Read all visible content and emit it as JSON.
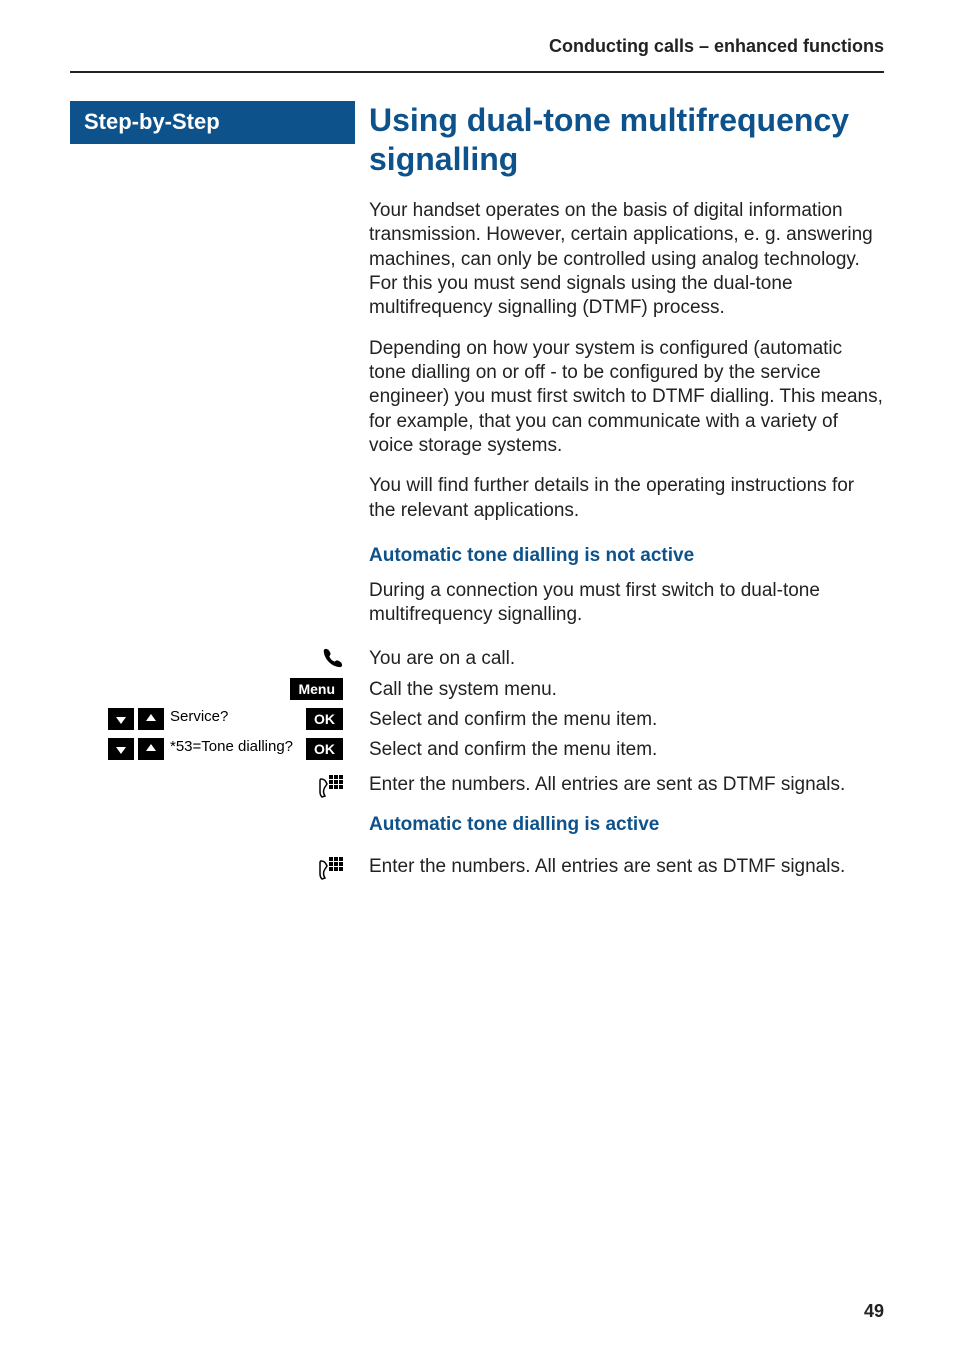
{
  "header": {
    "running_title": "Conducting calls – enhanced functions"
  },
  "sidebar": {
    "title": "Step-by-Step"
  },
  "main": {
    "title": "Using dual-tone multifrequency signalling",
    "paragraphs": [
      "Your handset operates on the basis of digital information transmission. However, certain applications, e. g. answering machines, can only be controlled using analog technology. For this you must send signals using the dual-tone multifrequency signalling (DTMF) process.",
      "Depending on how your system is configured (automatic tone dialling on or off - to be configured by the service engineer) you must first switch to DTMF dialling. This means, for example, that you can communicate with a variety of voice storage systems.",
      "You will find further details in the operating instructions for the relevant applications."
    ],
    "section_not_active": {
      "heading": "Automatic tone dialling is not active",
      "intro": "During a connection you must first switch to dual-tone multifrequency signalling.",
      "steps": [
        {
          "right": "You are on a call."
        },
        {
          "right": "Call the system menu."
        },
        {
          "right": "Select and confirm the menu item."
        },
        {
          "right": "Select and confirm the menu item."
        },
        {
          "right": "Enter the numbers. All entries are sent as DTMF signals."
        }
      ]
    },
    "section_active": {
      "heading": "Automatic tone dialling is active",
      "steps": [
        {
          "right": "Enter the numbers. All entries are sent as DTMF signals."
        }
      ]
    }
  },
  "left_controls": {
    "menu_label": "Menu",
    "ok_label": "OK",
    "service_item": "Service?",
    "tone_item": "*53=Tone dialling?"
  },
  "page_number": "49"
}
